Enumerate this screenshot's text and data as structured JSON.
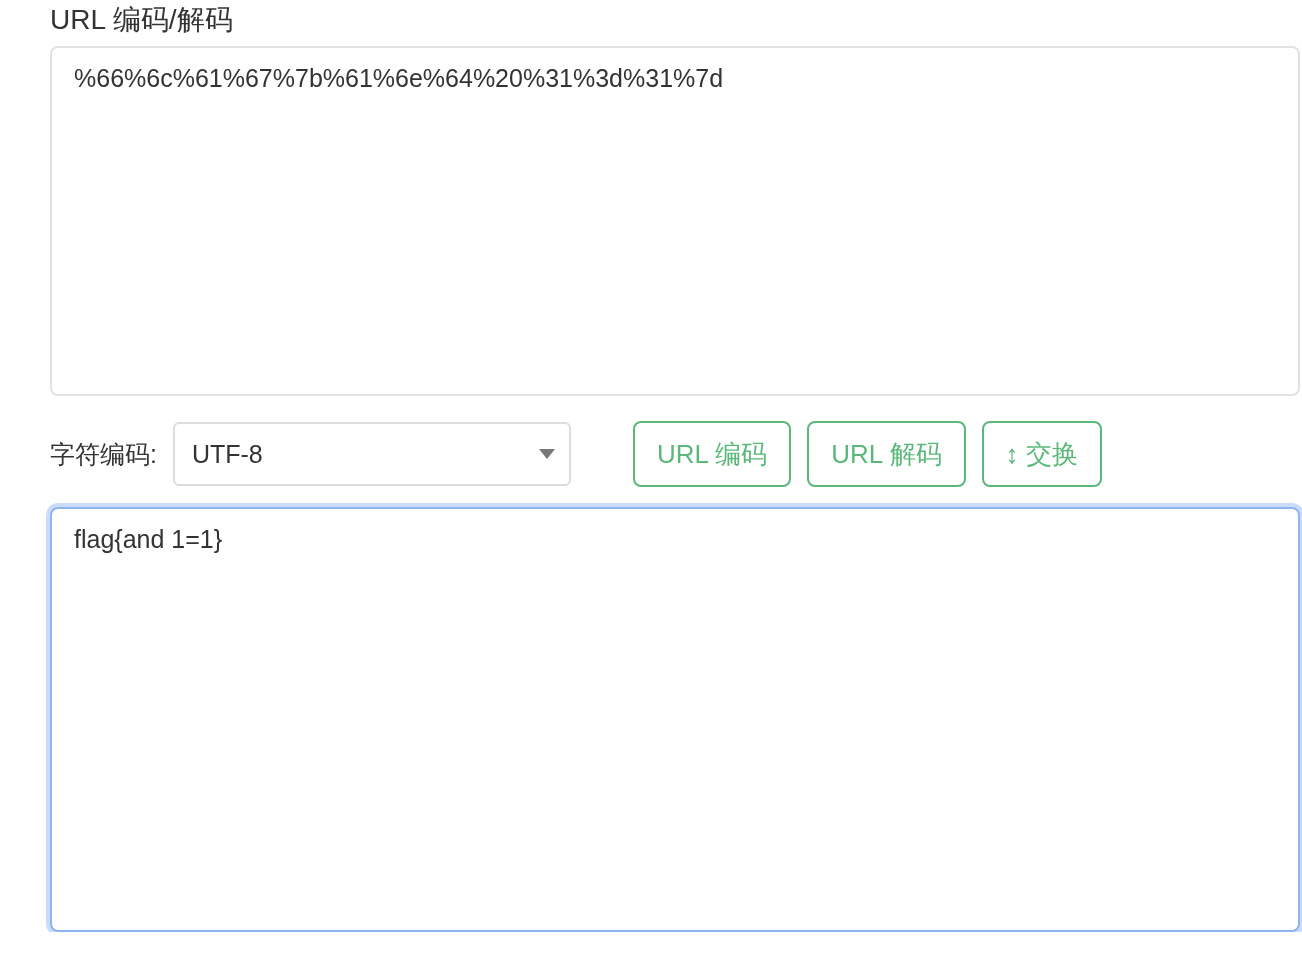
{
  "title": "URL 编码/解码",
  "input": {
    "value": "%66%6c%61%67%7b%61%6e%64%20%31%3d%31%7d",
    "focused": false
  },
  "charset": {
    "label": "字符编码:",
    "value": "UTF-8"
  },
  "buttons": [
    {
      "label": "URL 编码"
    },
    {
      "label": "URL 解码"
    },
    {
      "label": "↕ 交换"
    }
  ],
  "output": {
    "value": "flag{and 1=1}",
    "focused": true
  }
}
